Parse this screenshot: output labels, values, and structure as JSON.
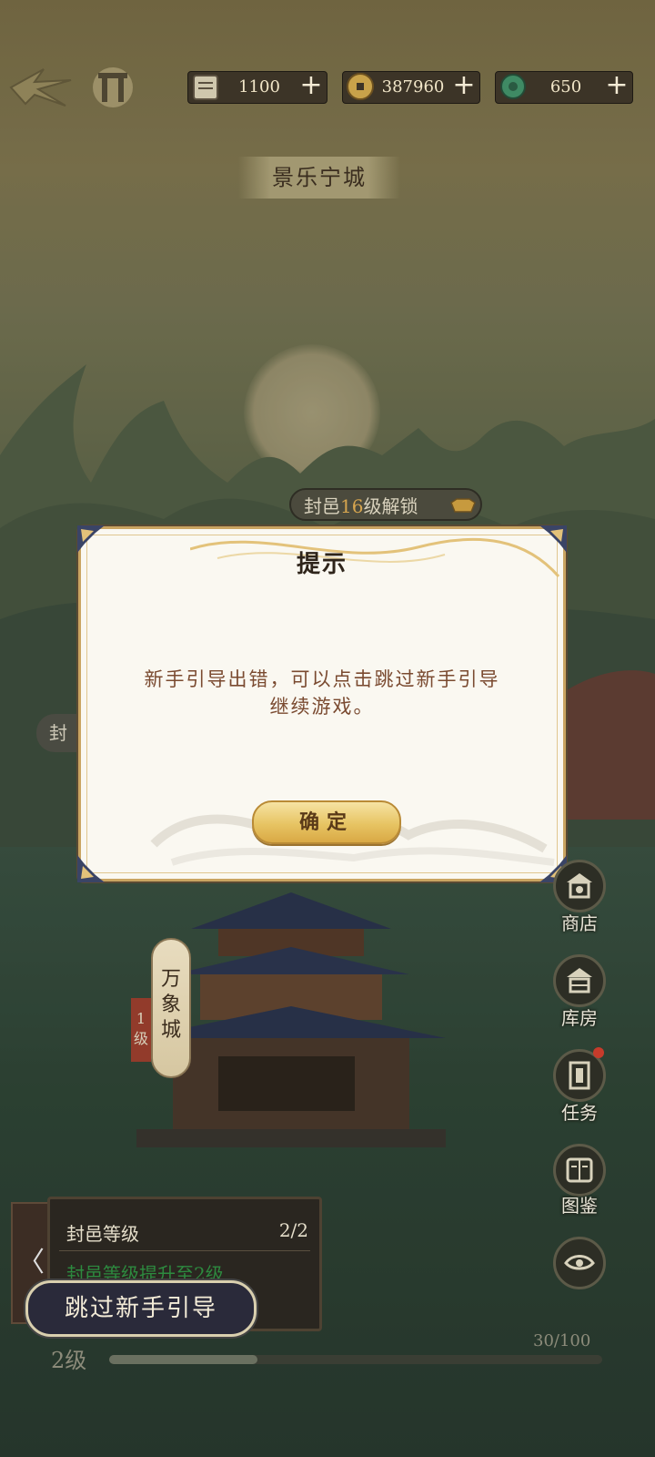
{
  "top_bar": {
    "resources": [
      {
        "icon": "scroll-icon",
        "value": "1100"
      },
      {
        "icon": "coin-icon",
        "value": "387960"
      },
      {
        "icon": "jade-icon",
        "value": "650"
      }
    ],
    "plus": "+"
  },
  "city_title": "景乐宁城",
  "unlock_pill": {
    "prefix": "封邑",
    "level": "16",
    "suffix": "级解锁"
  },
  "side_tag": "封",
  "dialog": {
    "title": "提示",
    "message_line1": "新手引导出错，可以点击跳过新手引导",
    "message_line2": "继续游戏。",
    "confirm": "确定"
  },
  "right_menu": [
    {
      "label": "商店",
      "icon": "shop-icon"
    },
    {
      "label": "库房",
      "icon": "warehouse-icon"
    },
    {
      "label": "任务",
      "icon": "task-icon"
    },
    {
      "label": "图鉴",
      "icon": "atlas-icon"
    },
    {
      "label": "",
      "icon": "eye-icon"
    }
  ],
  "city_banner": {
    "name": "万象城",
    "level": "1级"
  },
  "task_panel": {
    "title": "封邑等级",
    "count": "2/2",
    "goal": "封邑等级提升至2级",
    "arrow": "〈"
  },
  "skip_button": "跳过新手引导",
  "bottom": {
    "level": "2级",
    "xp_text": "30/100",
    "xp_fraction": 0.3
  },
  "colors": {
    "gold": "#d9a945",
    "goal_green": "#2d8a3f",
    "dialog_bg": "#faf8f1"
  }
}
